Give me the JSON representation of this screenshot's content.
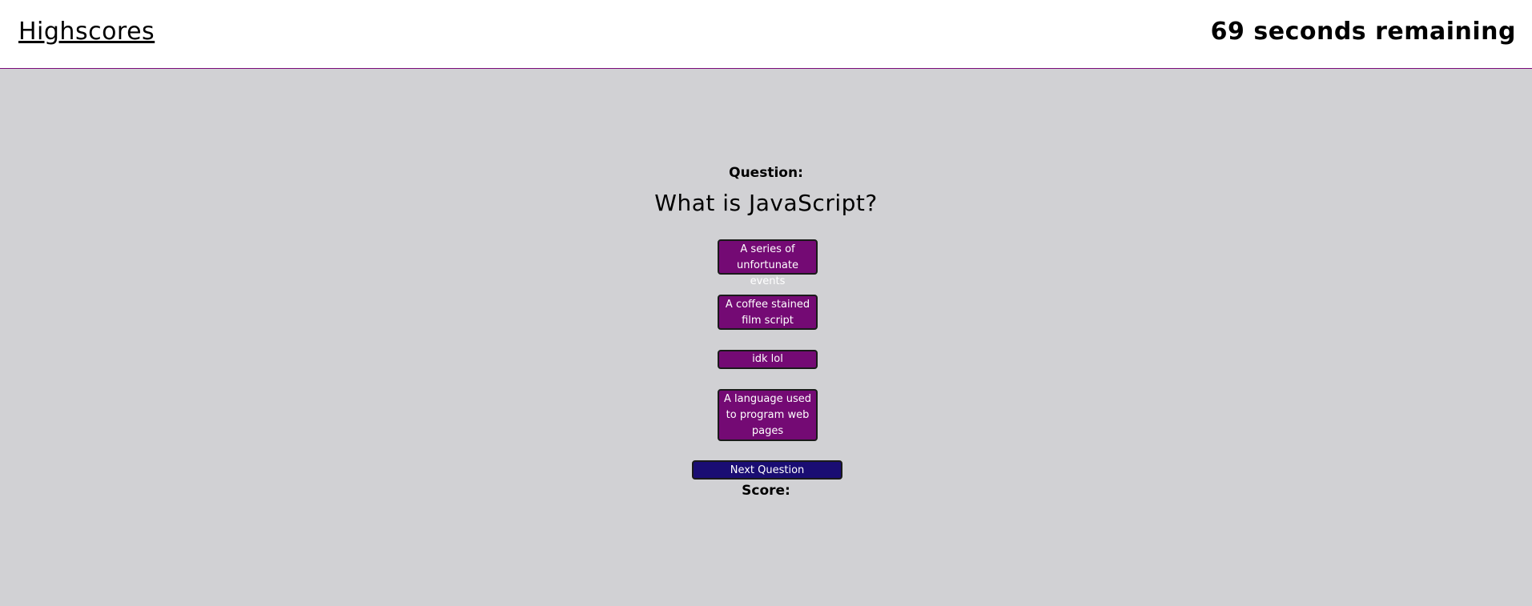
{
  "header": {
    "highscores_link": "Highscores",
    "timer_text": "69 seconds remaining"
  },
  "quiz": {
    "question_label": "Question:",
    "question_text": "What is JavaScript?",
    "answers": [
      "A series of unfortunate events",
      "A coffee stained film script",
      "idk lol",
      "A language used to program web pages"
    ],
    "next_button": "Next Question",
    "score_label": "Score:"
  },
  "colors": {
    "background": "#d1d1d4",
    "header_background": "#ffffff",
    "header_border": "#7a0a7a",
    "answer_button": "#740a74",
    "next_button": "#1a0d73"
  }
}
